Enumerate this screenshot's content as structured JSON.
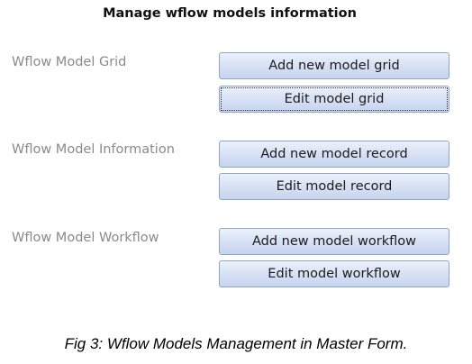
{
  "window": {
    "title": "Manage wflow models information"
  },
  "sections": [
    {
      "label": "Wflow Model Grid",
      "buttons": [
        "Add new model grid",
        "Edit model grid"
      ]
    },
    {
      "label": "Wflow Model Information",
      "buttons": [
        "Add new model record",
        "Edit model record"
      ]
    },
    {
      "label": "Wflow Model Workflow",
      "buttons": [
        "Add new model workflow",
        "Edit model workflow"
      ]
    }
  ],
  "focused_button": "Edit model grid",
  "caption": "Fig 3: Wflow Models Management in Master Form."
}
